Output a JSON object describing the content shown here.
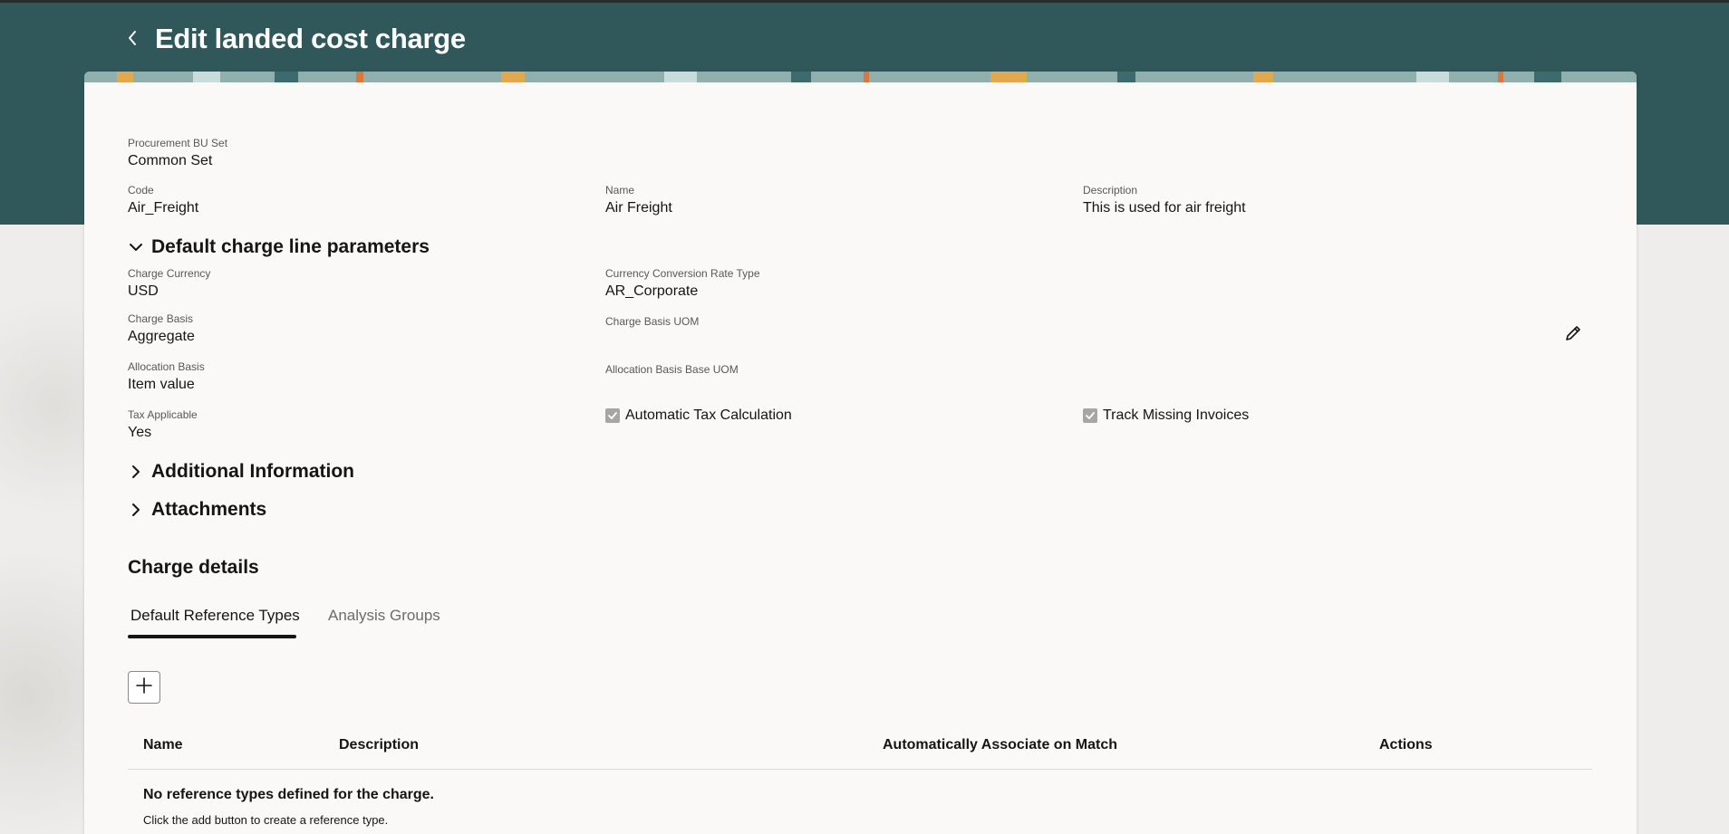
{
  "header": {
    "title": "Edit landed cost charge",
    "back_icon": "chevron-left-icon",
    "color": "#30585b"
  },
  "fields": {
    "procurement_bu_set": {
      "label": "Procurement BU Set",
      "value": "Common Set"
    },
    "code": {
      "label": "Code",
      "value": "Air_Freight"
    },
    "name": {
      "label": "Name",
      "value": "Air Freight"
    },
    "description": {
      "label": "Description",
      "value": "This is used for air freight"
    }
  },
  "default_charge_section": {
    "title": "Default charge line parameters",
    "charge_currency": {
      "label": "Charge Currency",
      "value": "USD"
    },
    "conversion_rate_type": {
      "label": "Currency Conversion Rate Type",
      "value": "AR_Corporate"
    },
    "charge_basis": {
      "label": "Charge Basis",
      "value": "Aggregate"
    },
    "charge_basis_uom": {
      "label": "Charge Basis UOM",
      "value": ""
    },
    "allocation_basis": {
      "label": "Allocation Basis",
      "value": "Item value"
    },
    "allocation_basis_base_uom": {
      "label": "Allocation Basis Base UOM",
      "value": ""
    },
    "tax_applicable": {
      "label": "Tax Applicable",
      "value": "Yes"
    },
    "automatic_tax_calculation": {
      "label": "Automatic Tax Calculation",
      "checked": true
    },
    "track_missing_invoices": {
      "label": "Track Missing Invoices",
      "checked": true
    },
    "edit_icon": "pencil-icon"
  },
  "collapsed_sections": {
    "additional_information": "Additional Information",
    "attachments": "Attachments"
  },
  "charge_details": {
    "title": "Charge details",
    "tabs": [
      {
        "label": "Default Reference Types",
        "active": true
      },
      {
        "label": "Analysis Groups",
        "active": false
      }
    ],
    "add_icon": "plus-icon",
    "columns": [
      "Name",
      "Description",
      "Automatically Associate on Match",
      "Actions"
    ],
    "empty_title": "No reference types defined for the charge.",
    "empty_message": "Click the add button to create a reference type."
  }
}
